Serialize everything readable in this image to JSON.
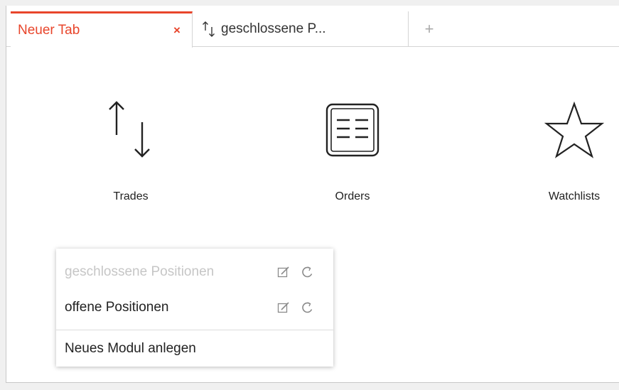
{
  "tabs": [
    {
      "label": "Neuer Tab",
      "active": true,
      "close_symbol": "×",
      "icon": null
    },
    {
      "label": "geschlossene P...",
      "active": false,
      "icon": "up-down-arrows-icon"
    }
  ],
  "add_tab_symbol": "+",
  "tiles": [
    {
      "label": "Trades",
      "icon": "up-down-arrows-icon"
    },
    {
      "label": "Orders",
      "icon": "list-document-icon"
    },
    {
      "label": "Watchlists",
      "icon": "star-icon"
    }
  ],
  "menu": {
    "items": [
      {
        "label": "geschlossene Positionen",
        "disabled": true,
        "actions": [
          "edit-icon",
          "refresh-icon"
        ]
      },
      {
        "label": "offene Positionen",
        "disabled": false,
        "actions": [
          "edit-icon",
          "refresh-icon"
        ]
      },
      {
        "label": "Neues Modul anlegen",
        "disabled": false,
        "actions": []
      }
    ]
  },
  "colors": {
    "accent": "#e8452b",
    "text": "#222222",
    "muted": "#c6c6c6",
    "border": "#d4d4d4"
  }
}
